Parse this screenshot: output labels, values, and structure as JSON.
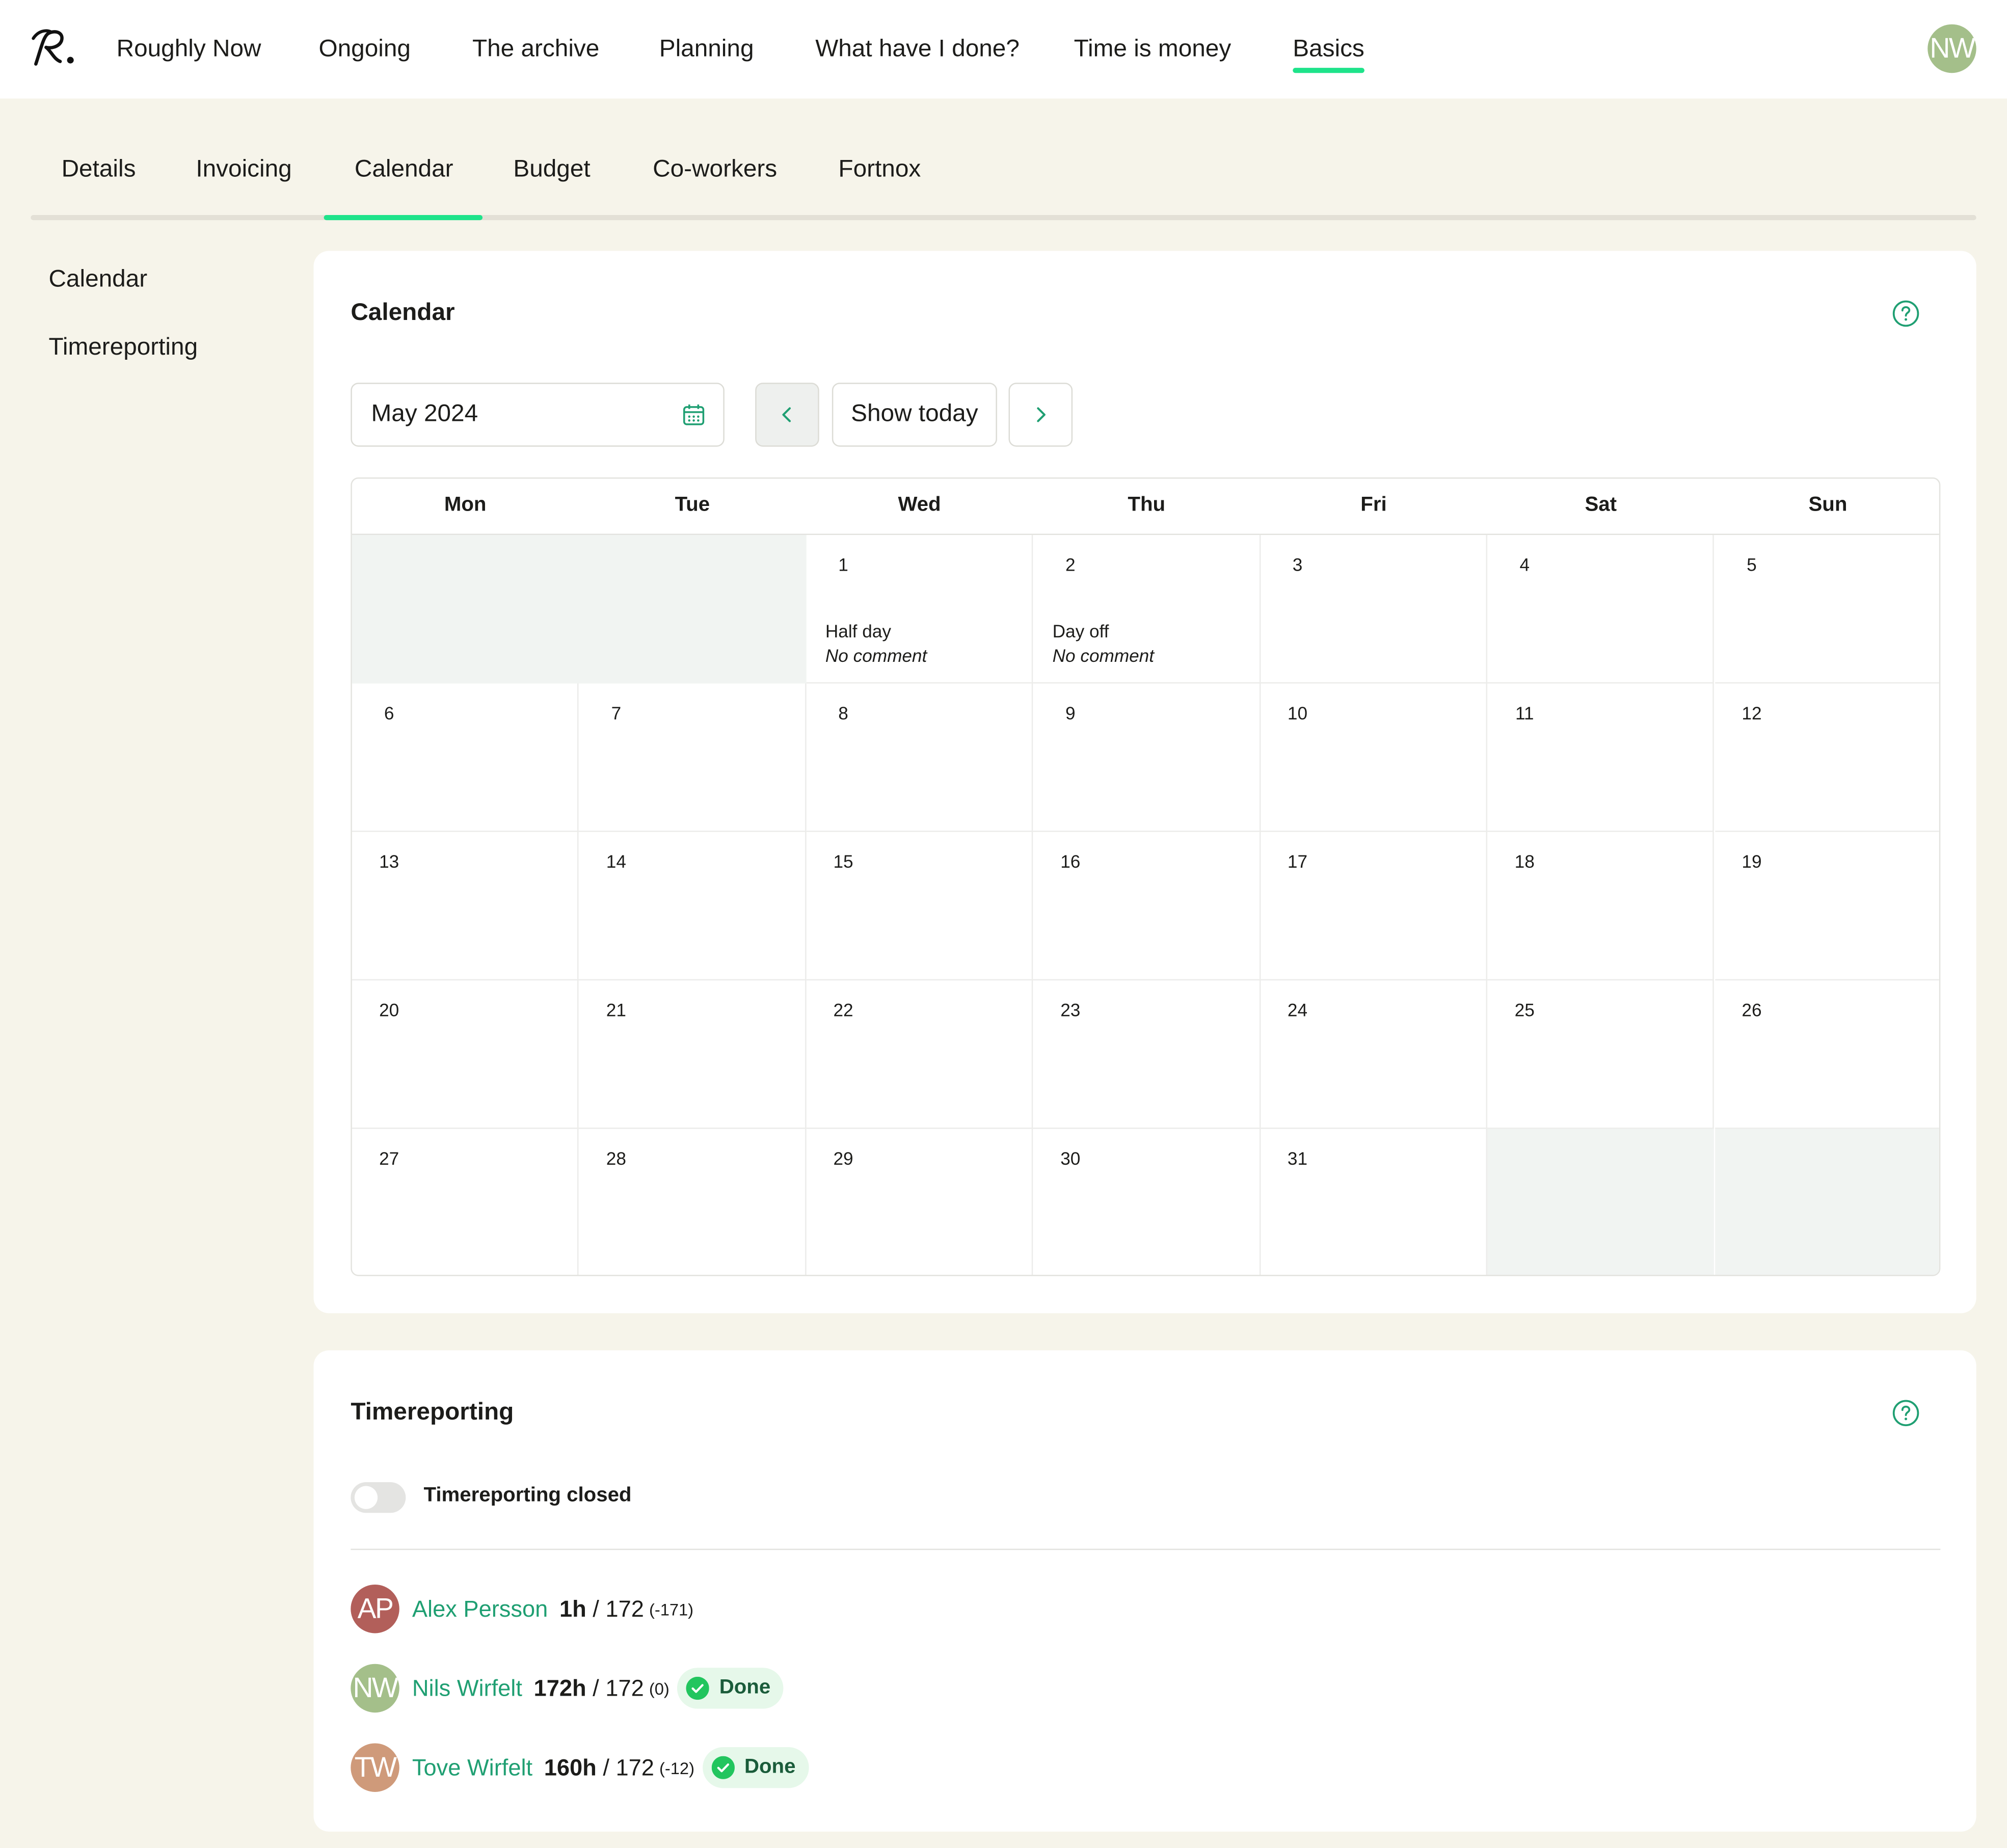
{
  "nav": {
    "items": [
      "Roughly Now",
      "Ongoing",
      "The archive",
      "Planning",
      "What have I done?",
      "Time is money",
      "Basics"
    ],
    "active": "Basics",
    "user_initials": "NW"
  },
  "tabs": {
    "items": [
      "Details",
      "Invoicing",
      "Calendar",
      "Budget",
      "Co-workers",
      "Fortnox"
    ],
    "active": "Calendar"
  },
  "sidebar": {
    "items": [
      "Calendar",
      "Timereporting"
    ]
  },
  "calendar": {
    "title": "Calendar",
    "month_value": "May 2024",
    "show_today_label": "Show today",
    "weekdays": [
      "Mon",
      "Tue",
      "Wed",
      "Thu",
      "Fri",
      "Sat",
      "Sun"
    ],
    "first_weekday_index": 2,
    "days_in_month": 31,
    "events": {
      "1": {
        "type": "Half day",
        "comment": "No comment"
      },
      "2": {
        "type": "Day off",
        "comment": "No comment"
      }
    }
  },
  "timereporting": {
    "title": "Timereporting",
    "closed_label": "Timereporting closed",
    "closed": false,
    "people": [
      {
        "initials": "AP",
        "name": "Alex Persson",
        "hours": "1h",
        "target": "/ 172",
        "diff": "(-171)",
        "status": "",
        "color": "#b25f5a"
      },
      {
        "initials": "NW",
        "name": "Nils Wirfelt",
        "hours": "172h",
        "target": "/ 172",
        "diff": "(0)",
        "status": "Done",
        "color": "#a4bf8a"
      },
      {
        "initials": "TW",
        "name": "Tove Wirfelt",
        "hours": "160h",
        "target": "/ 172",
        "diff": "(-12)",
        "status": "Done",
        "color": "#cf9a7a"
      }
    ]
  },
  "colors": {
    "accent": "#1ee38a",
    "link": "#1f9f72",
    "background": "#f6f4ea",
    "done_badge": "#e6f8ea"
  },
  "icons": [
    "logo",
    "calendar-icon",
    "chevron-left-icon",
    "chevron-right-icon",
    "help-icon",
    "check-icon"
  ]
}
